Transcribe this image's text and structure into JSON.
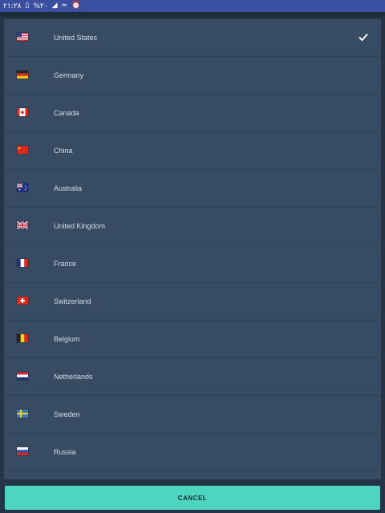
{
  "status_bar": {
    "time": "۲۱:۲۸",
    "battery": "%۲۰",
    "icons": [
      "battery-icon",
      "signal-icon",
      "wifi-icon",
      "alarm-icon"
    ]
  },
  "countries": [
    {
      "name": "United States",
      "flag": "us-flag-icon",
      "selected": true
    },
    {
      "name": "Germany",
      "flag": "de-flag-icon",
      "selected": false
    },
    {
      "name": "Canada",
      "flag": "ca-flag-icon",
      "selected": false
    },
    {
      "name": "China",
      "flag": "cn-flag-icon",
      "selected": false
    },
    {
      "name": "Australia",
      "flag": "au-flag-icon",
      "selected": false
    },
    {
      "name": "United Kingdom",
      "flag": "gb-flag-icon",
      "selected": false
    },
    {
      "name": "France",
      "flag": "fr-flag-icon",
      "selected": false
    },
    {
      "name": "Switzerland",
      "flag": "ch-flag-icon",
      "selected": false
    },
    {
      "name": "Belgium",
      "flag": "be-flag-icon",
      "selected": false
    },
    {
      "name": "Netherlands",
      "flag": "nl-flag-icon",
      "selected": false
    },
    {
      "name": "Sweden",
      "flag": "se-flag-icon",
      "selected": false
    },
    {
      "name": "Russia",
      "flag": "ru-flag-icon",
      "selected": false
    }
  ],
  "cancel_label": "CANCEL",
  "colors": {
    "accent": "#4ed5c0",
    "panel": "#374b63",
    "background": "#253447",
    "statusbar": "#3a4fa0"
  }
}
